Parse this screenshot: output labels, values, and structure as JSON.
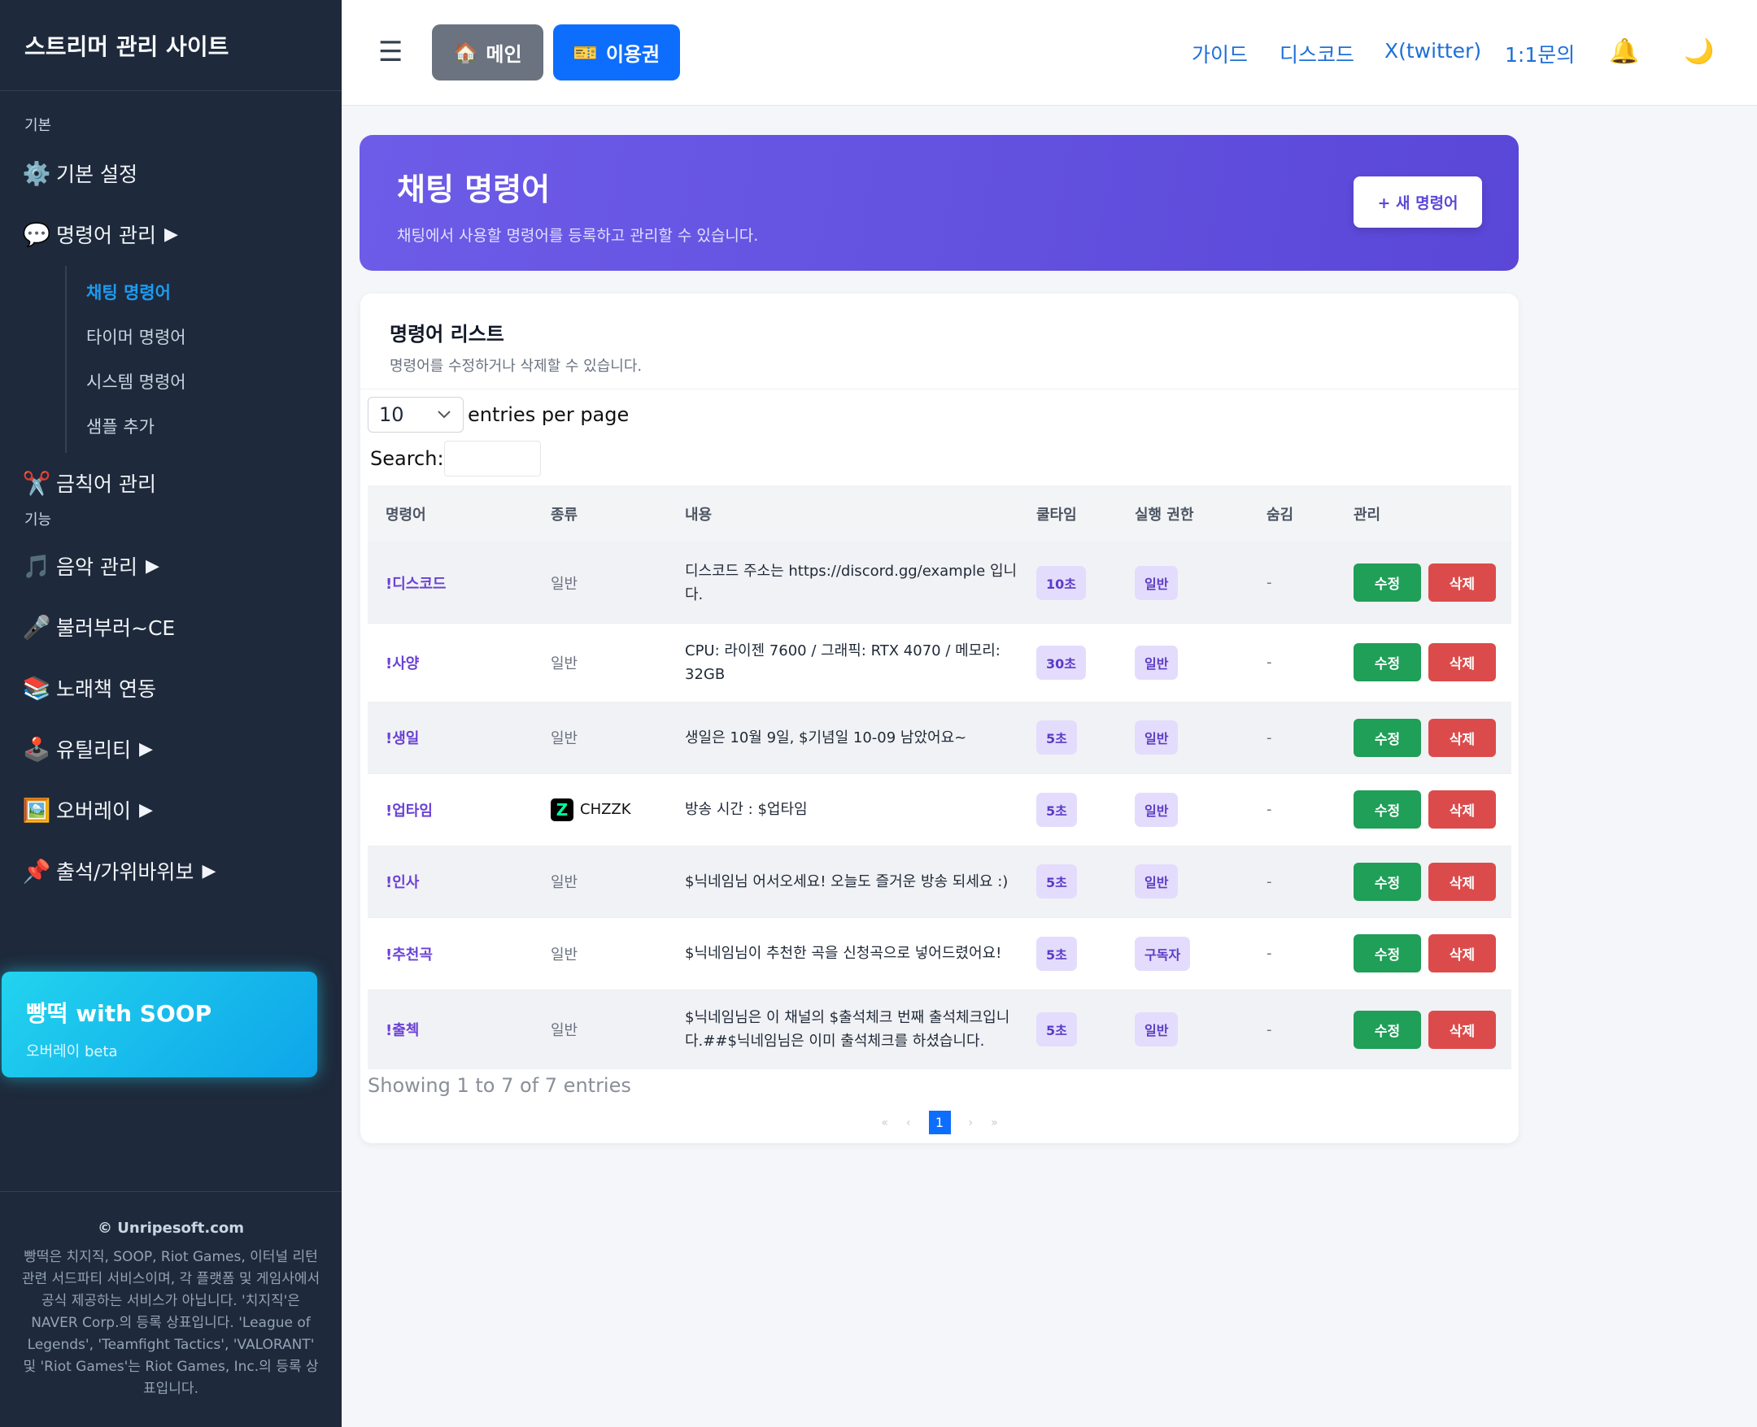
{
  "sidebar": {
    "brand": "스트리머 관리 사이트",
    "section_basic": "기본",
    "section_features": "기능",
    "basic_settings": {
      "icon": "gear-icon",
      "glyph": "⚙️",
      "label": "기본 설정"
    },
    "commands": {
      "icon": "speech-bubble-icon",
      "glyph": "💬",
      "label": "명령어 관리",
      "arrow": "▶"
    },
    "submenu": [
      {
        "label": "채팅 명령어",
        "active": true
      },
      {
        "label": "타이머 명령어",
        "active": false
      },
      {
        "label": "시스템 명령어",
        "active": false
      },
      {
        "label": "샘플 추가",
        "active": false
      }
    ],
    "banned_words": {
      "icon": "scissors-icon",
      "glyph": "✂️",
      "label": "금칙어 관리"
    },
    "music": {
      "icon": "music-note-icon",
      "glyph": "🎵",
      "label": "음악 관리",
      "arrow": "▶"
    },
    "bulleo": {
      "icon": "microphone-icon",
      "glyph": "🎤",
      "label": "불러부러~CE"
    },
    "songbook": {
      "icon": "books-icon",
      "glyph": "📚",
      "label": "노래책 연동"
    },
    "utility": {
      "icon": "joystick-icon",
      "glyph": "🕹️",
      "label": "유틸리티",
      "arrow": "▶"
    },
    "overlay": {
      "icon": "framed-picture-icon",
      "glyph": "🖼️",
      "label": "오버레이",
      "arrow": "▶"
    },
    "attendance": {
      "icon": "pushpin-icon",
      "glyph": "📌",
      "label": "출석/가위바위보",
      "arrow": "▶"
    },
    "promo": {
      "title": "빵떡 with SOOP",
      "subtitle": "오버레이 beta"
    },
    "footer": {
      "copyright": "© Unripesoft.com",
      "note": "빵떡은 치지직, SOOP, Riot Games, 이터널 리턴 관련 서드파티 서비스이며, 각 플랫폼 및 게임사에서 공식 제공하는 서비스가 아닙니다. '치지직'은 NAVER Corp.의 등록 상표입니다. 'League of Legends', 'Teamfight Tactics', 'VALORANT' 및 'Riot Games'는 Riot Games, Inc.의 등록 상표입니다."
    }
  },
  "topbar": {
    "menu_glyph": "☰",
    "main_button": {
      "icon": "house-icon",
      "glyph": "🏠",
      "label": "메인"
    },
    "pass_button": {
      "icon": "ticket-icon",
      "glyph": "🎫",
      "label": "이용권"
    },
    "links": [
      "가이드",
      "디스코드",
      "X(twitter)",
      "1:1문의"
    ],
    "bell_glyph": "🔔",
    "moon_glyph": "🌙"
  },
  "hero": {
    "title": "채팅 명령어",
    "subtitle": "채팅에서 사용할 명령어를 등록하고 관리할 수 있습니다.",
    "new_button": "+ 새 명령어"
  },
  "list": {
    "title": "명령어 리스트",
    "subtitle": "명령어를 수정하거나 삭제할 수 있습니다.",
    "entries_value": "10",
    "entries_label": "entries per page",
    "search_label": "Search:",
    "columns": [
      "명령어",
      "종류",
      "내용",
      "쿨타임",
      "실행 권한",
      "숨김",
      "관리"
    ],
    "rows": [
      {
        "cmd": "!디스코드",
        "type": "일반",
        "content": "디스코드 주소는 https://discord.gg/example 입니다.",
        "cooldown": "10초",
        "perm": "일반",
        "hidden": "-"
      },
      {
        "cmd": "!사양",
        "type": "일반",
        "content": "CPU: 라이젠 7600 / 그래픽: RTX 4070 / 메모리: 32GB",
        "cooldown": "30초",
        "perm": "일반",
        "hidden": "-"
      },
      {
        "cmd": "!생일",
        "type": "일반",
        "content": "생일은 10월 9일, $기념일 10-09 남았어요~",
        "cooldown": "5초",
        "perm": "일반",
        "hidden": "-"
      },
      {
        "cmd": "!업타임",
        "type": "CHZZK",
        "content": "방송 시간 : $업타임",
        "cooldown": "5초",
        "perm": "일반",
        "hidden": "-"
      },
      {
        "cmd": "!인사",
        "type": "일반",
        "content": "$닉네임님 어서오세요! 오늘도 즐거운 방송 되세요 :)",
        "cooldown": "5초",
        "perm": "일반",
        "hidden": "-"
      },
      {
        "cmd": "!추천곡",
        "type": "일반",
        "content": "$닉네임님이 추천한 곡을 신청곡으로 넣어드렸어요!",
        "cooldown": "5초",
        "perm": "구독자",
        "hidden": "-"
      },
      {
        "cmd": "!출첵",
        "type": "일반",
        "content": "$닉네임님은 이 채널의 $출석체크 번째 출석체크입니다.##$닉네임님은 이미 출석체크를 하셨습니다.",
        "cooldown": "5초",
        "perm": "일반",
        "hidden": "-"
      }
    ],
    "edit_label": "수정",
    "delete_label": "삭제",
    "chzzk_logo": "Z",
    "showing": "Showing 1 to 7 of 7 entries",
    "pager": {
      "first": "«",
      "prev": "‹",
      "current": "1",
      "next": "›",
      "last": "»"
    }
  },
  "colors": {
    "accent": "#0d6efd",
    "hero": "#6d5ce8",
    "sidebar": "#1e293b",
    "edit": "#1f9f57",
    "delete": "#dc4b4b"
  }
}
